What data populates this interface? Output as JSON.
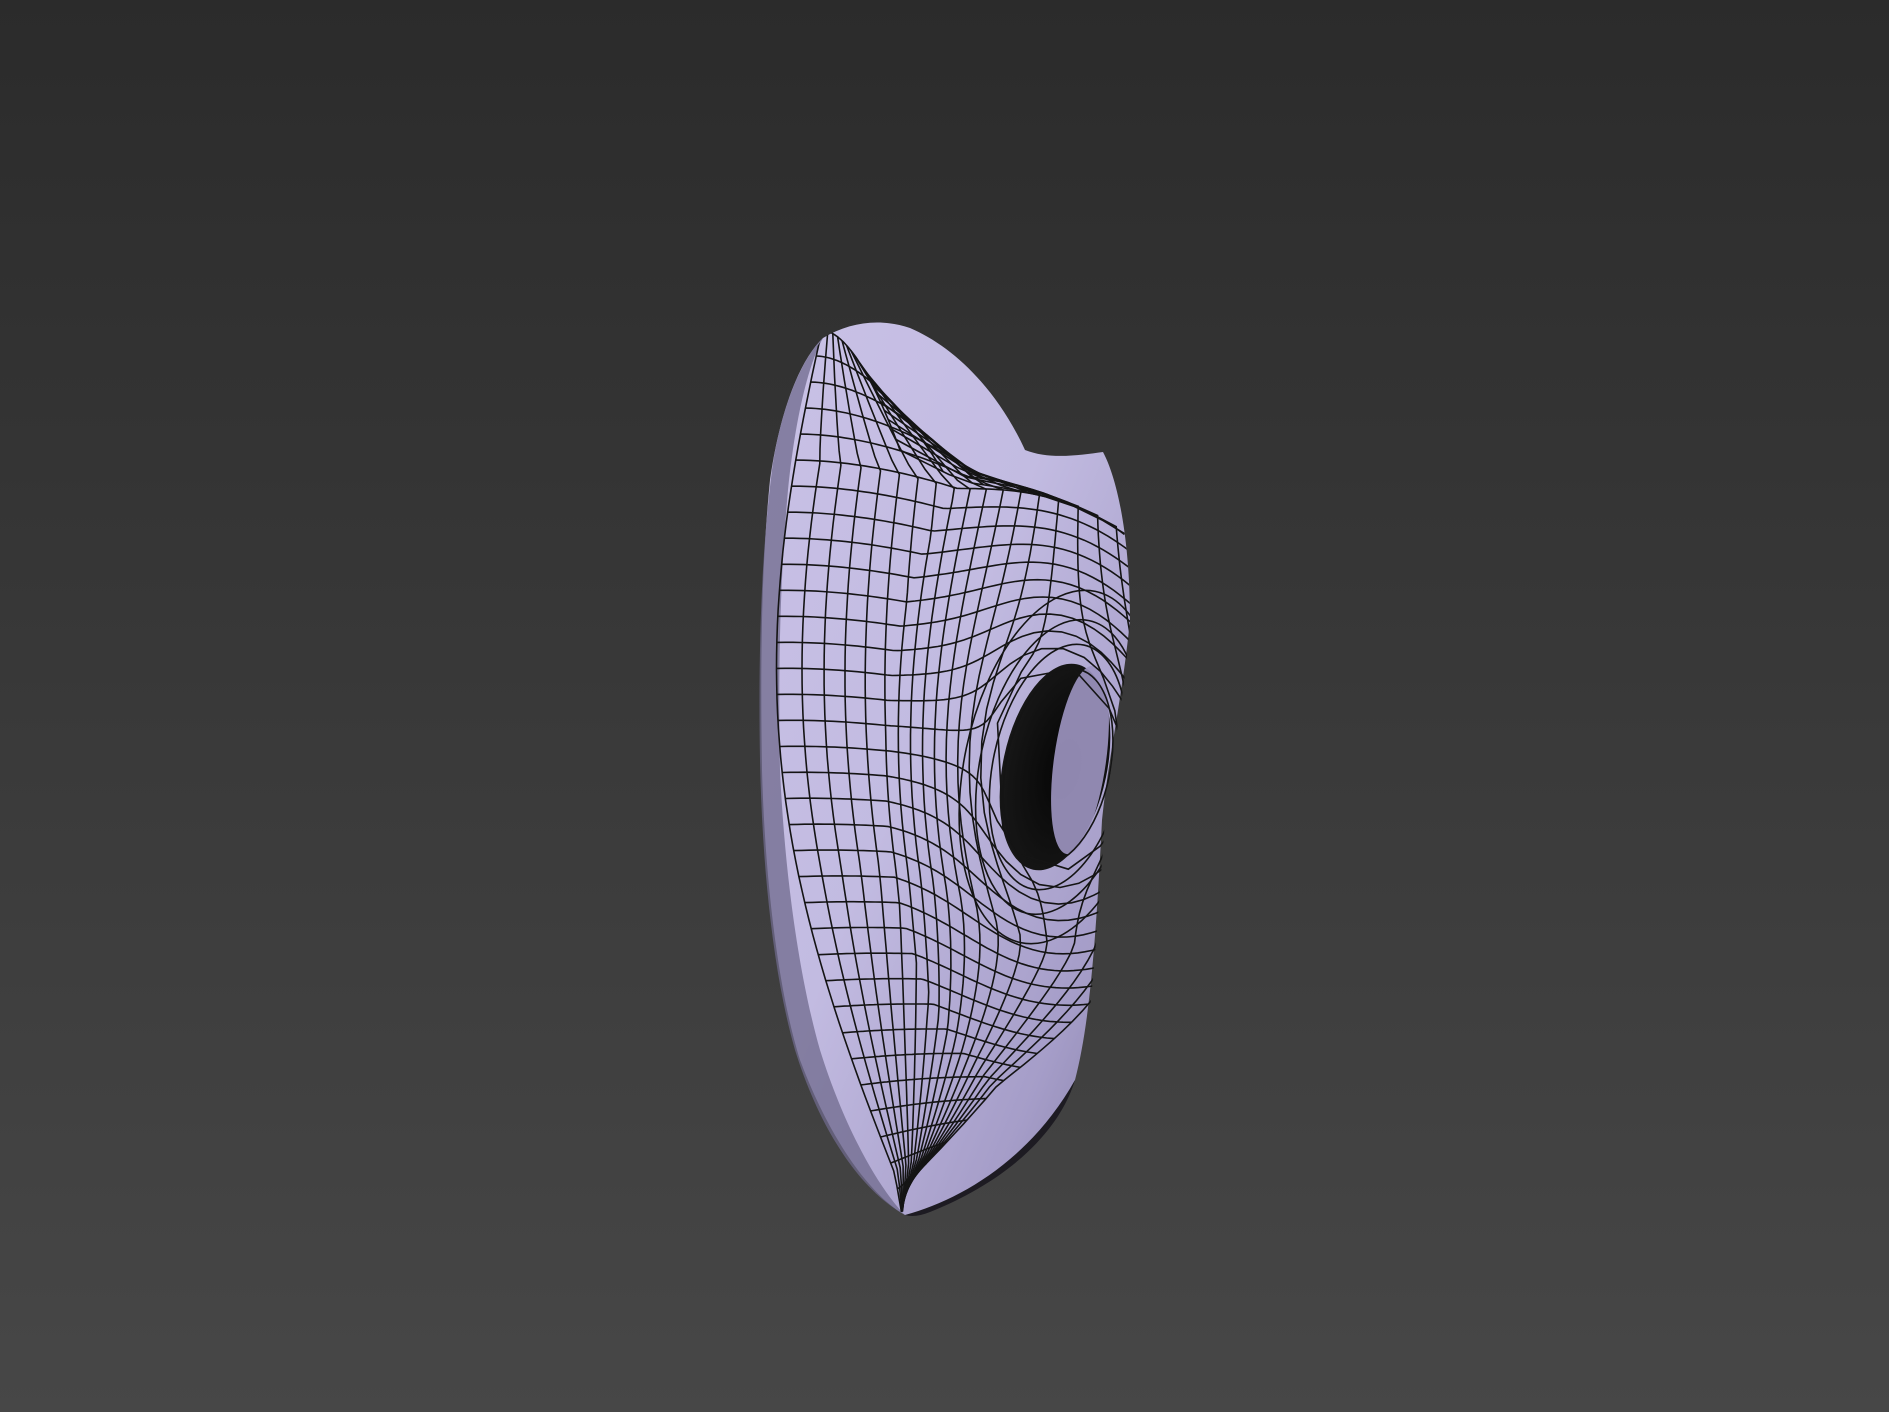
{
  "viewport": {
    "background_top": "#2b2b2b",
    "background_bottom": "#474747",
    "mesh_fill_light": "#cbc4e8",
    "mesh_fill_mid": "#aea6d2",
    "mesh_fill_dark": "#7f789e",
    "wire_color": "#141414",
    "hole_color": "#0c0c0c",
    "model": "subdivided-surface-wireframe"
  }
}
